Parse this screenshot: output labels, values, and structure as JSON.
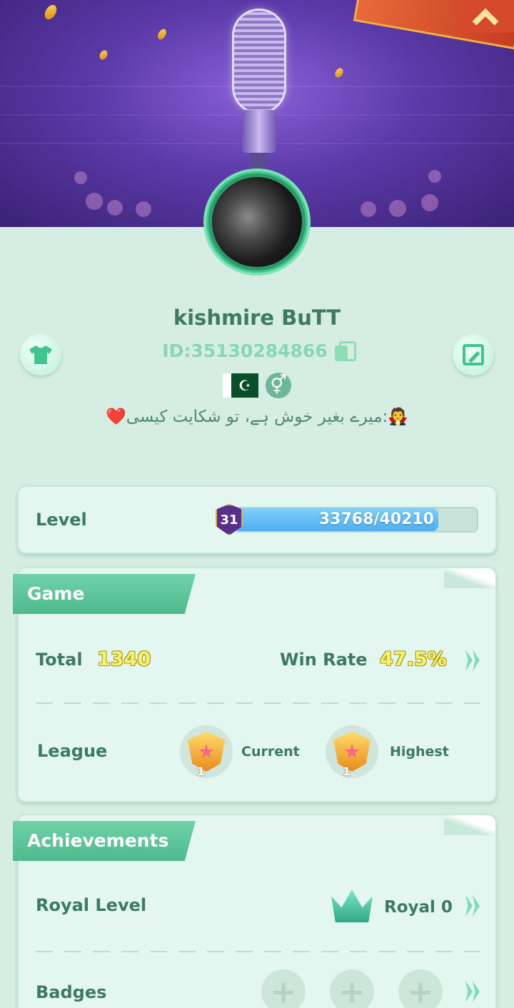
{
  "profile": {
    "name": "kishmire BuTT",
    "id_text": "ID:35130284866",
    "bio": "🧛:میرے بغیر خوش ہے، تو شکایت کیسی❤️",
    "flag_icon": "pakistan-flag",
    "gender_symbol": "⚥"
  },
  "level": {
    "label": "Level",
    "badge": "31",
    "progress_text": "33768/40210",
    "current": 33768,
    "max": 40210
  },
  "game": {
    "tab_label": "Game",
    "total_label": "Total",
    "total_value": "1340",
    "win_rate_label": "Win Rate",
    "win_rate_value": "47.5%",
    "league_label": "League",
    "current_label": "Current",
    "current_rank": "1",
    "highest_label": "Highest",
    "highest_rank": "1"
  },
  "achievements": {
    "tab_label": "Achievements",
    "royal_label": "Royal Level",
    "royal_value": "Royal 0",
    "badges_label": "Badges"
  },
  "colors": {
    "accent": "#4fb98d",
    "background": "#d6ede4",
    "progress": "#4faef0",
    "highlight_number": "#f8f16b"
  }
}
